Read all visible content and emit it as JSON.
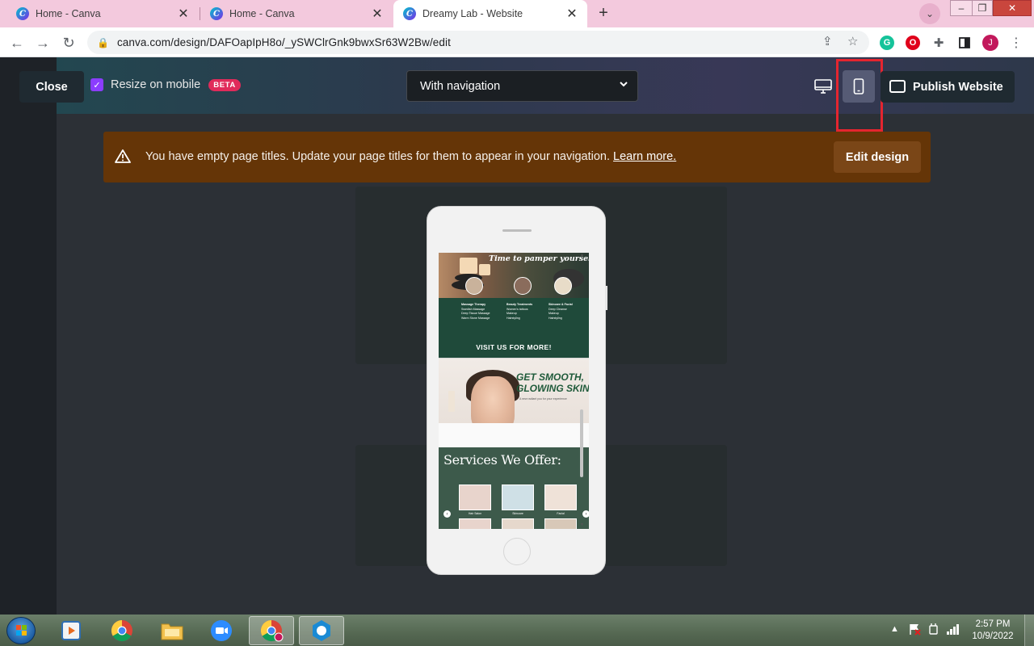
{
  "browser": {
    "tabs": [
      {
        "title": "Home - Canva",
        "active": false
      },
      {
        "title": "Home - Canva",
        "active": false
      },
      {
        "title": "Dreamy Lab - Website",
        "active": true
      }
    ],
    "url": "canva.com/design/DAFOapIpH8o/_ySWClrGnk9bwxSr63W2Bw/edit",
    "profile_initial": "J"
  },
  "preview_bar": {
    "close_label": "Close",
    "resize_label": "Resize on mobile",
    "beta_label": "BETA",
    "resize_checked": true,
    "navigation_select_value": "With navigation",
    "publish_label": "Publish Website",
    "active_device": "mobile"
  },
  "banner": {
    "message": "You have empty page titles. Update your page titles for them to appear in your navigation.",
    "link_label": "Learn more.",
    "edit_design_label": "Edit design",
    "background_color": "#653507"
  },
  "phone_site": {
    "section1": {
      "script_heading": "Time to pamper yourself!",
      "columns": [
        {
          "heading": "Massage Therapy",
          "items": [
            "Swedish Massage",
            "Deep Tissue Massage",
            "Warm Stone Massage"
          ]
        },
        {
          "heading": "Beauty Treatments",
          "items": [
            "Women's tattoos",
            "Makeup",
            "Hairstyling"
          ]
        },
        {
          "heading": "Skincare & Facial",
          "items": [
            "Deep Cleanse",
            "Makeup",
            "Hairstyling"
          ]
        }
      ],
      "cta": "VISIT US FOR MORE!"
    },
    "section2": {
      "headline_line1": "GET SMOOTH,",
      "headline_line2": "GLOWING SKIN",
      "subline": "A new radiant you for your experience"
    },
    "section3": {
      "heading": "Services We Offer:",
      "items": [
        {
          "label": "Hair Salon"
        },
        {
          "label": "Skincare"
        },
        {
          "label": "Facial"
        }
      ]
    }
  },
  "taskbar": {
    "clock_time": "2:57 PM",
    "clock_date": "10/9/2022"
  },
  "colors": {
    "accent_purple": "#8b3dff",
    "beta_red": "#e02b5a",
    "highlight_red": "#e5252f",
    "site_green": "#1f4a3a"
  }
}
